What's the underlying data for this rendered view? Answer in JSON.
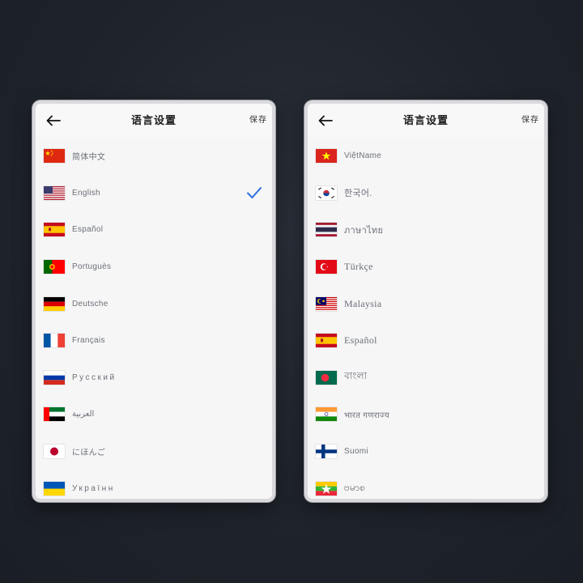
{
  "colors": {
    "background": "#1f242c",
    "accent": "#2f6fdc"
  },
  "left_screen": {
    "title": "语言设置",
    "save_label": "保存",
    "languages": [
      {
        "label": "简体中文",
        "flag": "china-flag-icon"
      },
      {
        "label": "English",
        "flag": "usa-flag-icon",
        "selected": true
      },
      {
        "label": "Español",
        "flag": "spain-flag-icon"
      },
      {
        "label": "Portuguès",
        "flag": "portugal-flag-icon"
      },
      {
        "label": "Deutsche",
        "flag": "germany-flag-icon"
      },
      {
        "label": "Français",
        "flag": "france-flag-icon"
      },
      {
        "label": "Русский",
        "flag": "russia-flag-icon"
      },
      {
        "label": "العربية",
        "flag": "uae-flag-icon"
      },
      {
        "label": "にほんご",
        "flag": "japan-flag-icon"
      },
      {
        "label": "Українн",
        "flag": "ukraine-flag-icon"
      }
    ]
  },
  "right_screen": {
    "title": "语言设置",
    "save_label": "保存",
    "languages": [
      {
        "label": "ViệtName",
        "flag": "vietnam-flag-icon"
      },
      {
        "label": "한국어.",
        "flag": "korea-flag-icon"
      },
      {
        "label": "ภาษาไทย",
        "flag": "thailand-flag-icon"
      },
      {
        "label": "Türkçe",
        "flag": "turkey-flag-icon"
      },
      {
        "label": "Malaysia",
        "flag": "malaysia-flag-icon"
      },
      {
        "label": "Español",
        "flag": "spain-flag-icon"
      },
      {
        "label": "বাংলা",
        "flag": "bangladesh-flag-icon"
      },
      {
        "label": "भारत गणराज्य",
        "flag": "india-flag-icon"
      },
      {
        "label": "Suomi",
        "flag": "finland-flag-icon"
      },
      {
        "label": "ဗမာစ",
        "flag": "myanmar-flag-icon"
      }
    ]
  }
}
